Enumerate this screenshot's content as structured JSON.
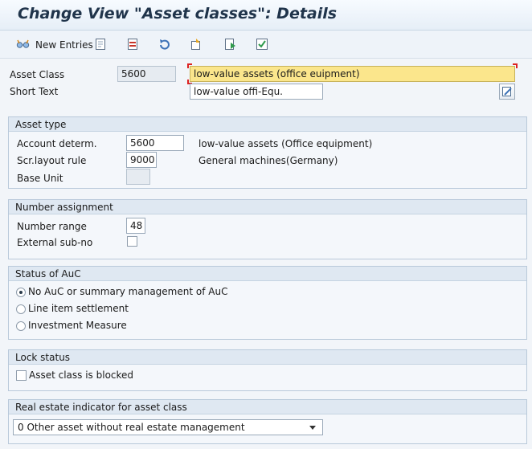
{
  "header": {
    "title": "Change View \"Asset classes\": Details"
  },
  "toolbar": {
    "new_entries": "New Entries"
  },
  "top": {
    "asset_class_label": "Asset Class",
    "asset_class_value": "5600",
    "asset_class_desc": "low-value assets (office euipment)",
    "short_text_label": "Short Text",
    "short_text_value": "low-value offi-Equ."
  },
  "asset_type": {
    "title": "Asset type",
    "account_determ_label": "Account determ.",
    "account_determ_value": "5600",
    "account_determ_desc": "low-value assets (Office equipment)",
    "scr_layout_label": "Scr.layout rule",
    "scr_layout_value": "9000",
    "scr_layout_desc": "General machines(Germany)",
    "base_unit_label": "Base Unit",
    "base_unit_value": ""
  },
  "number_assignment": {
    "title": "Number assignment",
    "number_range_label": "Number range",
    "number_range_value": "48",
    "external_sub_no_label": "External sub-no",
    "external_sub_no_checked": false
  },
  "status_auc": {
    "title": "Status of AuC",
    "options": [
      {
        "label": "No AuC or summary management of AuC",
        "selected": true
      },
      {
        "label": "Line item settlement",
        "selected": false
      },
      {
        "label": "Investment Measure",
        "selected": false
      }
    ]
  },
  "lock_status": {
    "title": "Lock status",
    "blocked_label": "Asset class is blocked",
    "blocked_checked": false
  },
  "real_estate": {
    "title": "Real estate indicator for asset class",
    "selected": "0 Other asset without real estate management"
  },
  "colors": {
    "highlight": "#fbe68c",
    "group_header": "#dfe8f2",
    "title_text": "#20344b"
  }
}
